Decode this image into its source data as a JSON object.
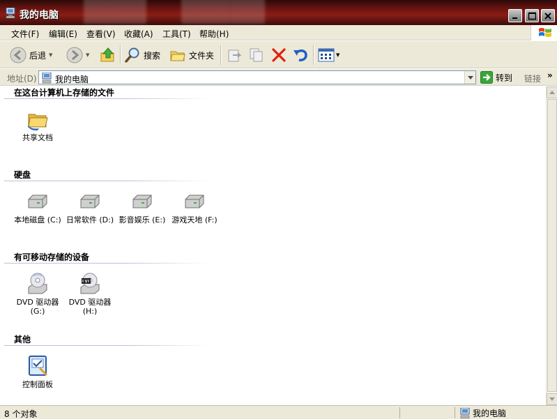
{
  "window": {
    "title": "我的电脑",
    "icon": "my-computer-icon",
    "controls": {
      "minimize": "minimize-icon",
      "maximize": "maximize-icon",
      "close": "close-icon"
    }
  },
  "menu": {
    "items": [
      {
        "label": "文件(F)"
      },
      {
        "label": "编辑(E)"
      },
      {
        "label": "查看(V)"
      },
      {
        "label": "收藏(A)"
      },
      {
        "label": "工具(T)"
      },
      {
        "label": "帮助(H)"
      }
    ]
  },
  "toolbar": {
    "back_label": "后退",
    "search_label": "搜索",
    "folders_label": "文件夹"
  },
  "address": {
    "label": "地址(D)",
    "value": "我的电脑",
    "go_label": "转到",
    "links_label": "链接",
    "links_chevron": "»"
  },
  "groups": [
    {
      "header": "在这台计算机上存储的文件",
      "items": [
        {
          "label": "共享文档",
          "icon": "shared-folder-icon"
        }
      ]
    },
    {
      "header": "硬盘",
      "items": [
        {
          "label": "本地磁盘 (C:)",
          "icon": "hard-drive-icon"
        },
        {
          "label": "日常软件 (D:)",
          "icon": "hard-drive-icon"
        },
        {
          "label": "影音娱乐 (E:)",
          "icon": "hard-drive-icon"
        },
        {
          "label": "游戏天地 (F:)",
          "icon": "hard-drive-icon"
        }
      ]
    },
    {
      "header": "有可移动存储的设备",
      "items": [
        {
          "label": "DVD 驱动器",
          "sub": "(G:)",
          "icon": "dvd-drive-icon"
        },
        {
          "label": "DVD 驱动器",
          "sub": "(H:)",
          "icon": "dvd-drive-icon"
        }
      ]
    },
    {
      "header": "其他",
      "items": [
        {
          "label": "控制面板",
          "icon": "control-panel-icon"
        }
      ]
    }
  ],
  "status": {
    "left": "8 个对象",
    "right": "我的电脑"
  },
  "colors": {
    "title_bar": "#6b1410",
    "chrome": "#ece9d8",
    "group_line": "#b9c4d6",
    "delete_red": "#e02010",
    "undo_blue": "#1a5fc8"
  }
}
